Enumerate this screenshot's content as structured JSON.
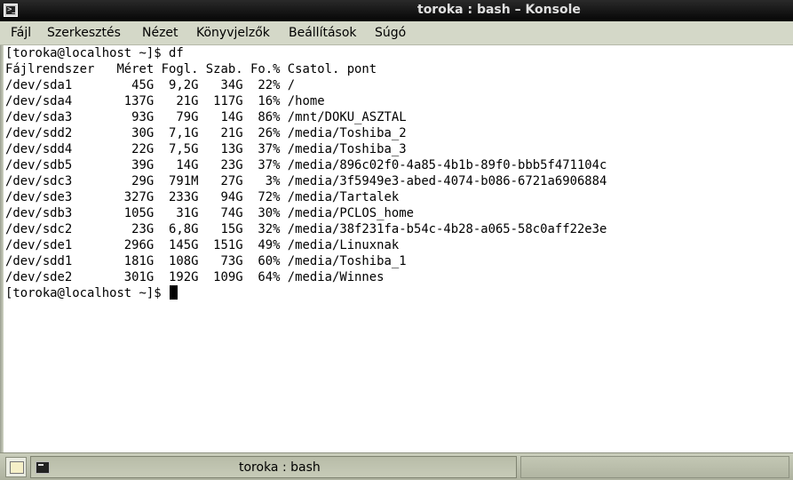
{
  "window": {
    "title": "toroka : bash – Konsole",
    "icon": "terminal-icon"
  },
  "menubar": {
    "items": [
      {
        "label": "Fájl"
      },
      {
        "label": "Szerkesztés"
      },
      {
        "label": "Nézet"
      },
      {
        "label": "Könyvjelzők"
      },
      {
        "label": "Beállítások"
      },
      {
        "label": "Súgó"
      }
    ]
  },
  "terminal": {
    "lines": [
      "[toroka@localhost ~]$ df",
      "Fájlrendszer   Méret Fogl. Szab. Fo.% Csatol. pont",
      "/dev/sda1        45G  9,2G   34G  22% /",
      "/dev/sda4       137G   21G  117G  16% /home",
      "/dev/sda3        93G   79G   14G  86% /mnt/DOKU_ASZTAL",
      "/dev/sdd2        30G  7,1G   21G  26% /media/Toshiba_2",
      "/dev/sdd4        22G  7,5G   13G  37% /media/Toshiba_3",
      "/dev/sdb5        39G   14G   23G  37% /media/896c02f0-4a85-4b1b-89f0-bbb5f471104c",
      "/dev/sdc3        29G  791M   27G   3% /media/3f5949e3-abed-4074-b086-6721a6906884",
      "/dev/sde3       327G  233G   94G  72% /media/Tartalek",
      "/dev/sdb3       105G   31G   74G  30% /media/PCLOS_home",
      "/dev/sdc2        23G  6,8G   15G  32% /media/38f231fa-b54c-4b28-a065-58c0aff22e3e",
      "/dev/sde1       296G  145G  151G  49% /media/Linuxnak",
      "/dev/sdd1       181G  108G   73G  60% /media/Toshiba_1",
      "/dev/sde2       301G  192G  109G  64% /media/Winnes"
    ],
    "prompt": "[toroka@localhost ~]$ "
  },
  "taskbar": {
    "task_label": "toroka : bash",
    "task_icon": "terminal-icon",
    "start_icon": "folder-icon"
  }
}
